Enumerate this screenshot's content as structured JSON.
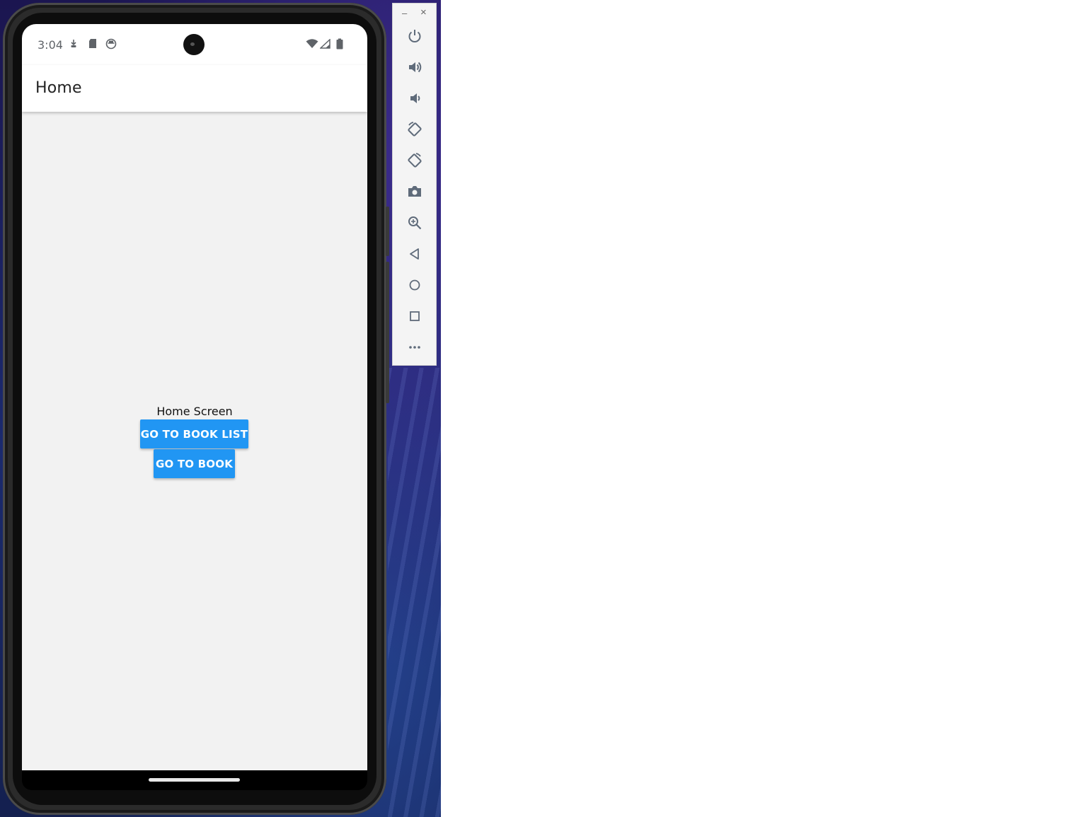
{
  "status_bar": {
    "time": "3:04",
    "left_icons": [
      "download-icon",
      "sd-card-icon",
      "app-notification-icon"
    ],
    "right_icons": [
      "wifi-icon",
      "cell-signal-icon",
      "battery-icon"
    ]
  },
  "app_bar": {
    "title": "Home"
  },
  "main": {
    "label": "Home Screen",
    "buttons": {
      "book_list": "GO TO BOOK LIST",
      "book": "GO TO BOOK"
    }
  },
  "emulator_toolbar": {
    "window_controls": {
      "minimize": "–",
      "close": "×"
    },
    "items": [
      "power-icon",
      "volume-up-icon",
      "volume-down-icon",
      "rotate-left-icon",
      "rotate-right-icon",
      "camera-icon",
      "zoom-icon",
      "back-icon",
      "home-icon",
      "overview-icon",
      "more-icon"
    ]
  },
  "colors": {
    "accent": "#2196f3",
    "content_background": "#f2f2f2",
    "toolbar_icon": "#5f6b7a"
  }
}
